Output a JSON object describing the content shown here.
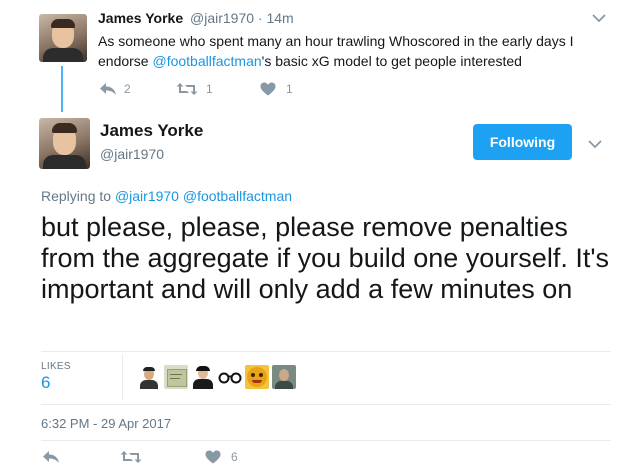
{
  "parent_tweet": {
    "name": "James Yorke",
    "handle": "@jair1970",
    "time": "14m",
    "text_before": "As someone who spent many an hour trawling Whoscored in the early days I endorse ",
    "mention": "@footballfactman",
    "text_after": "'s basic xG model to get people interested",
    "reply_count": "2",
    "retweet_count": "1",
    "like_count": "1"
  },
  "main_tweet": {
    "name": "James Yorke",
    "handle": "@jair1970",
    "follow_label": "Following",
    "replying_prefix": "Replying to",
    "replying_to": [
      "@jair1970",
      "@footballfactman"
    ],
    "text": "but please, please, please remove penalties from the aggregate if you build one yourself. It's important and will only add a few minutes on",
    "likes_label": "LIKES",
    "likes_count": "6",
    "timestamp": "6:32 PM - 29 Apr 2017",
    "footer_like_count": "6"
  },
  "colors": {
    "accent": "#1da1f2",
    "link": "#1b95e0",
    "thread_line": "#4ab3f4",
    "muted": "#657786",
    "icon": "#8899a6"
  }
}
